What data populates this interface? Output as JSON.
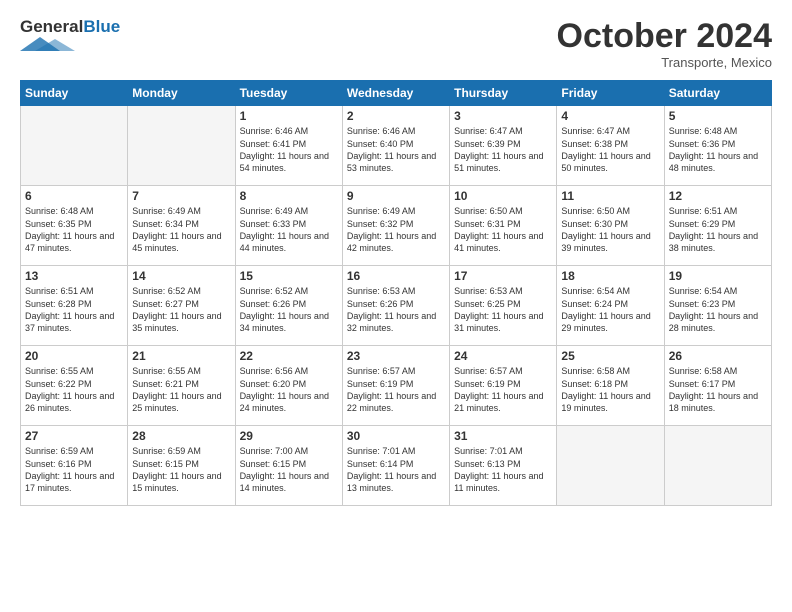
{
  "header": {
    "logo_general": "General",
    "logo_blue": "Blue",
    "month_title": "October 2024",
    "subtitle": "Transporte, Mexico"
  },
  "days_of_week": [
    "Sunday",
    "Monday",
    "Tuesday",
    "Wednesday",
    "Thursday",
    "Friday",
    "Saturday"
  ],
  "weeks": [
    [
      {
        "day": "",
        "empty": true
      },
      {
        "day": "",
        "empty": true
      },
      {
        "day": "1",
        "sunrise": "6:46 AM",
        "sunset": "6:41 PM",
        "daylight": "11 hours and 54 minutes."
      },
      {
        "day": "2",
        "sunrise": "6:46 AM",
        "sunset": "6:40 PM",
        "daylight": "11 hours and 53 minutes."
      },
      {
        "day": "3",
        "sunrise": "6:47 AM",
        "sunset": "6:39 PM",
        "daylight": "11 hours and 51 minutes."
      },
      {
        "day": "4",
        "sunrise": "6:47 AM",
        "sunset": "6:38 PM",
        "daylight": "11 hours and 50 minutes."
      },
      {
        "day": "5",
        "sunrise": "6:48 AM",
        "sunset": "6:36 PM",
        "daylight": "11 hours and 48 minutes."
      }
    ],
    [
      {
        "day": "6",
        "sunrise": "6:48 AM",
        "sunset": "6:35 PM",
        "daylight": "11 hours and 47 minutes."
      },
      {
        "day": "7",
        "sunrise": "6:49 AM",
        "sunset": "6:34 PM",
        "daylight": "11 hours and 45 minutes."
      },
      {
        "day": "8",
        "sunrise": "6:49 AM",
        "sunset": "6:33 PM",
        "daylight": "11 hours and 44 minutes."
      },
      {
        "day": "9",
        "sunrise": "6:49 AM",
        "sunset": "6:32 PM",
        "daylight": "11 hours and 42 minutes."
      },
      {
        "day": "10",
        "sunrise": "6:50 AM",
        "sunset": "6:31 PM",
        "daylight": "11 hours and 41 minutes."
      },
      {
        "day": "11",
        "sunrise": "6:50 AM",
        "sunset": "6:30 PM",
        "daylight": "11 hours and 39 minutes."
      },
      {
        "day": "12",
        "sunrise": "6:51 AM",
        "sunset": "6:29 PM",
        "daylight": "11 hours and 38 minutes."
      }
    ],
    [
      {
        "day": "13",
        "sunrise": "6:51 AM",
        "sunset": "6:28 PM",
        "daylight": "11 hours and 37 minutes."
      },
      {
        "day": "14",
        "sunrise": "6:52 AM",
        "sunset": "6:27 PM",
        "daylight": "11 hours and 35 minutes."
      },
      {
        "day": "15",
        "sunrise": "6:52 AM",
        "sunset": "6:26 PM",
        "daylight": "11 hours and 34 minutes."
      },
      {
        "day": "16",
        "sunrise": "6:53 AM",
        "sunset": "6:26 PM",
        "daylight": "11 hours and 32 minutes."
      },
      {
        "day": "17",
        "sunrise": "6:53 AM",
        "sunset": "6:25 PM",
        "daylight": "11 hours and 31 minutes."
      },
      {
        "day": "18",
        "sunrise": "6:54 AM",
        "sunset": "6:24 PM",
        "daylight": "11 hours and 29 minutes."
      },
      {
        "day": "19",
        "sunrise": "6:54 AM",
        "sunset": "6:23 PM",
        "daylight": "11 hours and 28 minutes."
      }
    ],
    [
      {
        "day": "20",
        "sunrise": "6:55 AM",
        "sunset": "6:22 PM",
        "daylight": "11 hours and 26 minutes."
      },
      {
        "day": "21",
        "sunrise": "6:55 AM",
        "sunset": "6:21 PM",
        "daylight": "11 hours and 25 minutes."
      },
      {
        "day": "22",
        "sunrise": "6:56 AM",
        "sunset": "6:20 PM",
        "daylight": "11 hours and 24 minutes."
      },
      {
        "day": "23",
        "sunrise": "6:57 AM",
        "sunset": "6:19 PM",
        "daylight": "11 hours and 22 minutes."
      },
      {
        "day": "24",
        "sunrise": "6:57 AM",
        "sunset": "6:19 PM",
        "daylight": "11 hours and 21 minutes."
      },
      {
        "day": "25",
        "sunrise": "6:58 AM",
        "sunset": "6:18 PM",
        "daylight": "11 hours and 19 minutes."
      },
      {
        "day": "26",
        "sunrise": "6:58 AM",
        "sunset": "6:17 PM",
        "daylight": "11 hours and 18 minutes."
      }
    ],
    [
      {
        "day": "27",
        "sunrise": "6:59 AM",
        "sunset": "6:16 PM",
        "daylight": "11 hours and 17 minutes."
      },
      {
        "day": "28",
        "sunrise": "6:59 AM",
        "sunset": "6:15 PM",
        "daylight": "11 hours and 15 minutes."
      },
      {
        "day": "29",
        "sunrise": "7:00 AM",
        "sunset": "6:15 PM",
        "daylight": "11 hours and 14 minutes."
      },
      {
        "day": "30",
        "sunrise": "7:01 AM",
        "sunset": "6:14 PM",
        "daylight": "11 hours and 13 minutes."
      },
      {
        "day": "31",
        "sunrise": "7:01 AM",
        "sunset": "6:13 PM",
        "daylight": "11 hours and 11 minutes."
      },
      {
        "day": "",
        "empty": true
      },
      {
        "day": "",
        "empty": true
      }
    ]
  ]
}
